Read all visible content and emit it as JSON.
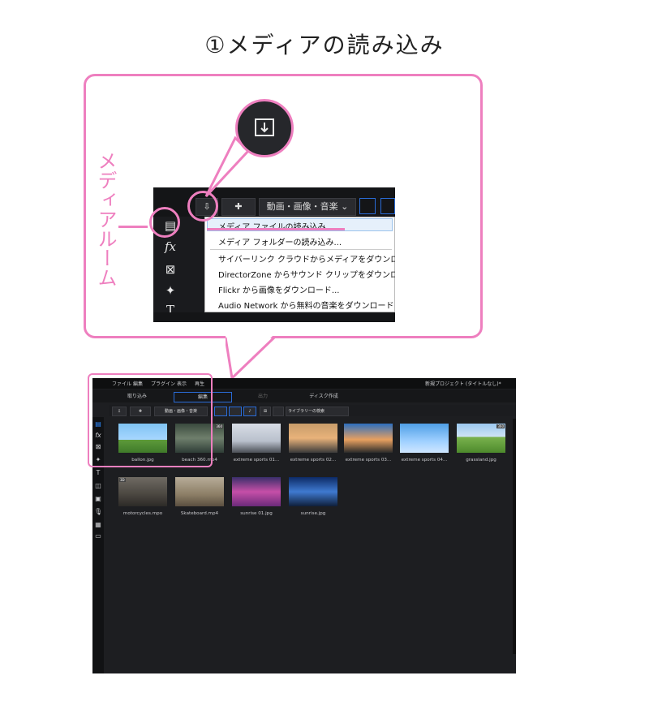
{
  "title": "①メディアの読み込み",
  "callout": {
    "side_label": "メディアルーム",
    "dropdown_label": "動画・画像・音楽",
    "menu_items": [
      "メディア ファイルの読み込み...",
      "メディア フォルダーの読み込み...",
      "サイバーリンク クラウドからメディアをダウンロード...",
      "DirectorZone からサウンド クリップをダウンロード...",
      "Flickr から画像をダウンロード...",
      "Audio Network から無料の音楽をダウンロード"
    ]
  },
  "app": {
    "menu": [
      "ファイル",
      "編集",
      "プラグイン",
      "表示",
      "再生"
    ],
    "project_title": "新規プロジェクト (タイトルなし)*",
    "tabs": [
      "取り込み",
      "編集",
      "出力",
      "ディスク作成"
    ],
    "active_tab": "編集",
    "toolbar": {
      "dropdown": "動画・画像・音楽",
      "search_placeholder": "ライブラリーの検索"
    },
    "media": [
      {
        "name": "ballon.jpg",
        "badge": ""
      },
      {
        "name": "beach 360.mp4",
        "badge": "360"
      },
      {
        "name": "extreme sports 01...",
        "badge": ""
      },
      {
        "name": "extreme sports 02...",
        "badge": ""
      },
      {
        "name": "extreme sports 03...",
        "badge": ""
      },
      {
        "name": "extreme sports 04...",
        "badge": ""
      },
      {
        "name": "grassland.jpg",
        "badge": "360"
      },
      {
        "name": "motorcycles.mpo",
        "badge": "3D"
      },
      {
        "name": "Skateboard.mp4",
        "badge": ""
      },
      {
        "name": "sunrise 01.jpg",
        "badge": ""
      },
      {
        "name": "sunrise.jpg",
        "badge": ""
      }
    ]
  },
  "colors": {
    "accent_pink": "#ee7fbf",
    "ui_blue": "#2a6bd6"
  }
}
